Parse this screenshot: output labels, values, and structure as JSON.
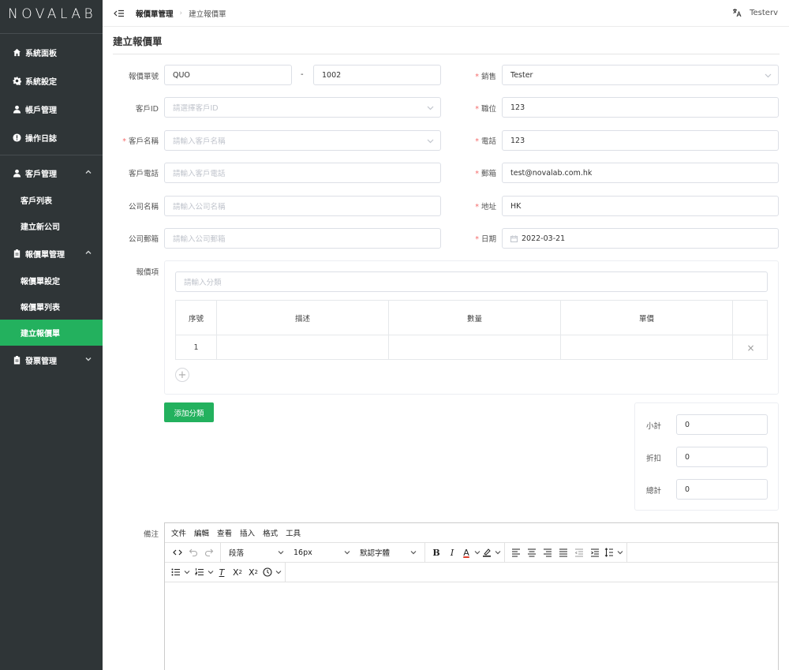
{
  "brand": {
    "logo": "NOVALAB"
  },
  "sidebar": {
    "items": [
      {
        "label": "系統面板",
        "icon": "home-icon"
      },
      {
        "label": "系統設定",
        "icon": "gear-icon"
      },
      {
        "label": "帳戶管理",
        "icon": "user-icon"
      },
      {
        "label": "操作日誌",
        "icon": "alert-icon"
      }
    ],
    "groups": [
      {
        "label": "客戶管理",
        "icon": "user-icon",
        "expanded": true,
        "children": [
          "客戶列表",
          "建立新公司"
        ]
      },
      {
        "label": "報價單管理",
        "icon": "clipboard-icon",
        "expanded": true,
        "children": [
          "報價單設定",
          "報價單列表",
          "建立報價單"
        ]
      },
      {
        "label": "發票管理",
        "icon": "clipboard-icon",
        "expanded": false,
        "children": []
      }
    ],
    "active_item": "建立報價單",
    "accent": "#23b15e"
  },
  "header": {
    "breadcrumb": [
      "報價單管理",
      "建立報價單"
    ],
    "user": "Tester",
    "user_dropdown": "v"
  },
  "page": {
    "title": "建立報價單"
  },
  "form": {
    "left": {
      "quote_no_label": "報價單號",
      "quote_prefix": "QUO",
      "quote_sep": "-",
      "quote_number": "1002",
      "customer_id_label": "客戶ID",
      "customer_id_placeholder": "請選擇客戶ID",
      "customer_name_label": "客戶名稱",
      "customer_name_placeholder": "請輸入客戶名稱",
      "customer_phone_label": "客戶電話",
      "customer_phone_placeholder": "請輸入客戶電話",
      "company_name_label": "公司名稱",
      "company_name_placeholder": "請輸入公司名稱",
      "company_email_label": "公司郵箱",
      "company_email_placeholder": "請輸入公司郵箱"
    },
    "right": {
      "sales_label": "銷售",
      "sales_value": "Tester",
      "title_label": "職位",
      "title_value": "123",
      "phone_label": "電話",
      "phone_value": "123",
      "email_label": "郵箱",
      "email_value": "test@novalab.com.hk",
      "address_label": "地址",
      "address_value": "HK",
      "date_label": "日期",
      "date_value": "2022-03-21"
    },
    "items": {
      "label": "報價項",
      "category_placeholder": "請輸入分類",
      "columns": [
        "序號",
        "描述",
        "數量",
        "單價"
      ],
      "rows": [
        {
          "no": "1",
          "desc": "",
          "qty": "",
          "price": ""
        }
      ],
      "remove_icon": "×",
      "add_icon": "+",
      "add_category_button": "添加分類"
    },
    "totals": {
      "subtotal_label": "小計",
      "subtotal": "0",
      "discount_label": "折扣",
      "discount": "0",
      "total_label": "總計",
      "total": "0"
    },
    "remarks": {
      "label": "備注",
      "menubar": [
        "文件",
        "編輯",
        "查看",
        "插入",
        "格式",
        "工具"
      ],
      "block_format": "段落",
      "font_size": "16px",
      "font_family": "默認字體",
      "format_clear": "T",
      "subscript": "X",
      "subscript_mark": "2",
      "superscript": "X",
      "superscript_mark": "2"
    }
  }
}
